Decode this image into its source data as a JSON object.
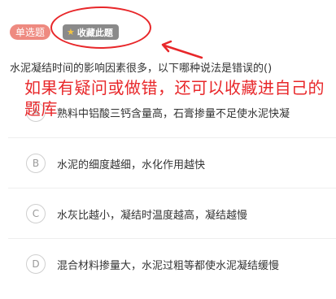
{
  "header": {
    "type_tag": "单选题",
    "favorite_label": "收藏此题"
  },
  "question": {
    "text": "水泥凝结时间的影响因素很多，以下哪种说法是错误的()"
  },
  "annotation": {
    "text": "如果有疑问或做错，还可以收藏进自己的题库",
    "color": "#e8272a"
  },
  "options": [
    {
      "letter": "A",
      "text": "熟料中铝酸三钙含量高，石膏掺量不足使水泥快凝"
    },
    {
      "letter": "B",
      "text": "水泥的细度越细，水化作用越快"
    },
    {
      "letter": "C",
      "text": "水灰比越小，凝结时温度越高，凝结越慢"
    },
    {
      "letter": "D",
      "text": "混合材料掺量大，水泥过粗等都使水泥凝结缓慢"
    }
  ],
  "colors": {
    "tag_bg": "#ee8a80",
    "favorite_bg": "#8a8a8a",
    "star": "#f4c542"
  },
  "icons": {
    "favorite": "star-icon"
  }
}
